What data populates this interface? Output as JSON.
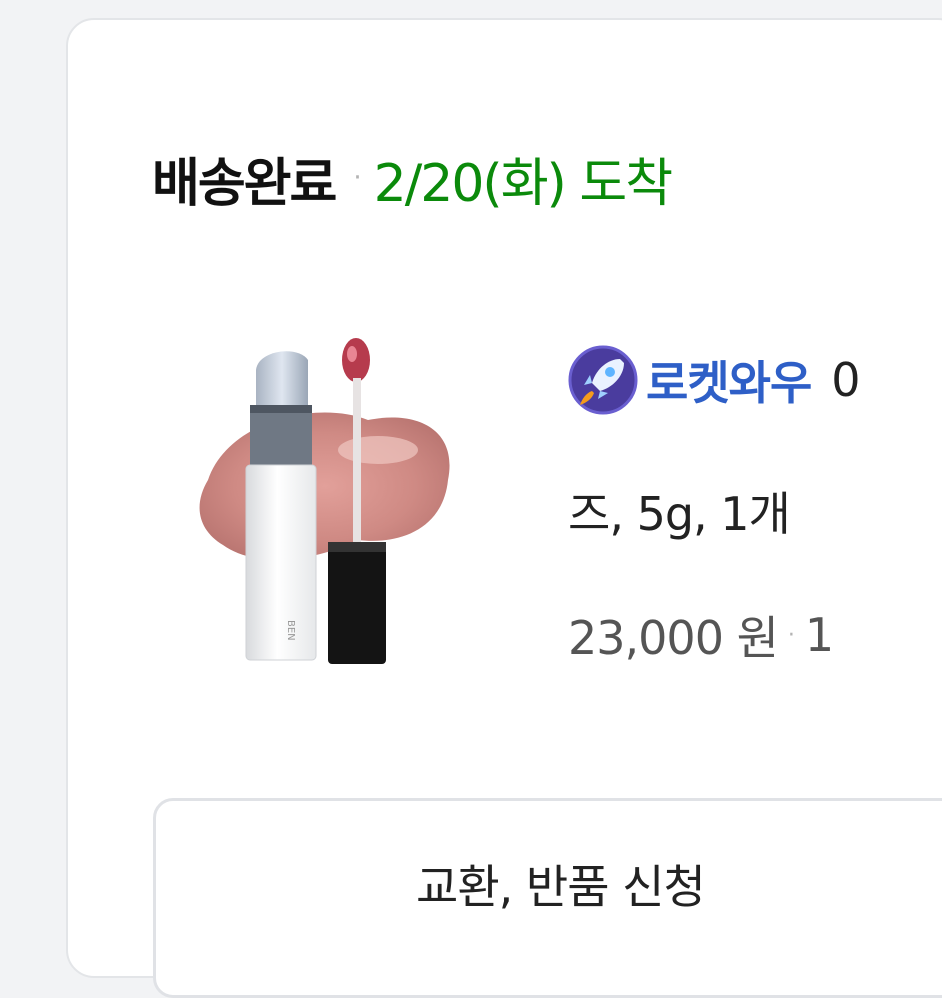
{
  "order": {
    "status": "배송완료",
    "separator": "·",
    "arrival": "2/20(화) 도착"
  },
  "product": {
    "thumbnail_icon": "lip-tint-product-image",
    "badge_icon": "rocket-icon",
    "badge_label": "로켓와우",
    "name_cut": "0",
    "name_line2": "즈, 5g, 1개",
    "price": "23,000 원",
    "price_separator": "·",
    "quantity_cut": "1"
  },
  "actions": {
    "exchange_return_label": "교환, 반품 신청"
  },
  "colors": {
    "arrival_green": "#0b8a0b",
    "badge_blue": "#2e5fc7",
    "rocket_bg": "#4a3c9e"
  }
}
